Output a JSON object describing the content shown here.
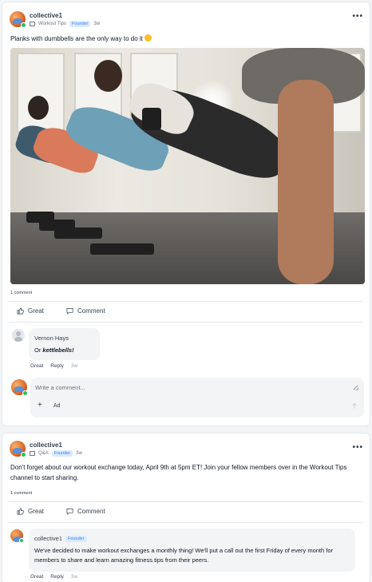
{
  "colors": {
    "accent": "#3b82f6",
    "badge_bg": "#dbeafe",
    "online": "#22c55e"
  },
  "post1": {
    "author": "collective1",
    "channel": "Workout Tips",
    "badge": "Founder",
    "time": "3w",
    "menu_icon": "more-horizontal-icon",
    "text": "Planks with dumbbells are the only way to do it",
    "emoji": "grinning-face-emoji",
    "comment_count": "1 comment",
    "actions": {
      "great": "Great",
      "comment": "Comment"
    },
    "comment": {
      "name": "Vernon Hays",
      "text_prefix": "Or ",
      "text_emphasis": "kettlebells!",
      "great": "Great",
      "reply": "Reply",
      "time": "3w"
    },
    "composer": {
      "placeholder": "Write a comment...",
      "add_label": "+",
      "ad_label": "Ad"
    }
  },
  "post2": {
    "author": "collective1",
    "channel": "Q&A",
    "badge": "Founder",
    "time": "3w",
    "menu_icon": "more-horizontal-icon",
    "text": "Don't forget about our workout exchange today, April 9th at 5pm ET! Join your fellow members over in the Workout Tips channel to start sharing.",
    "comment_count": "1 comment",
    "actions": {
      "great": "Great",
      "comment": "Comment"
    },
    "comment": {
      "name": "collective1",
      "badge": "Founder",
      "text": "We've decided to make workout exchanges a monthly thing! We'll put a call out the first Friday of every month for members to share and learn amazing fitness tips from their peers.",
      "great": "Great",
      "reply": "Reply",
      "time": "3w"
    }
  }
}
